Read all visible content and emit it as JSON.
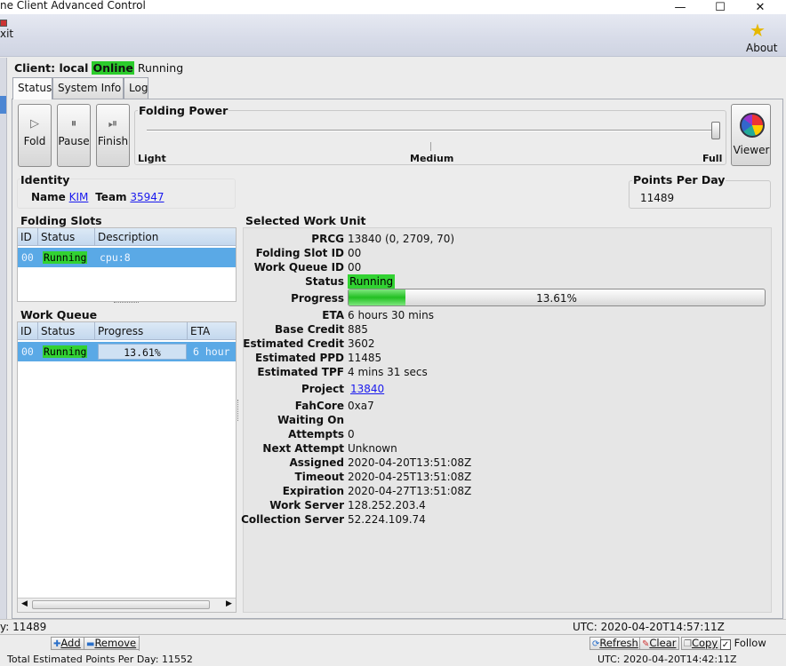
{
  "window": {
    "title": "ne Client Advanced Control",
    "minimize_glyph": "—",
    "maximize_glyph": "☐",
    "close_glyph": "✕"
  },
  "menu": {
    "exit_label": "xit",
    "about_label": "About",
    "about_icon": "star-icon"
  },
  "client": {
    "label": "Client: local",
    "online": "Online",
    "state": "Running"
  },
  "tabs": [
    "Status",
    "System Info",
    "Log"
  ],
  "controls": {
    "fold": "Fold",
    "pause": "Pause",
    "finish": "Finish",
    "viewer": "Viewer",
    "fold_glyph": "▷",
    "pause_glyph": "⏸",
    "finish_glyph": "⏯"
  },
  "folding_power": {
    "title": "Folding Power",
    "light": "Light",
    "medium": "Medium",
    "full": "Full",
    "level": 1.0
  },
  "identity": {
    "title": "Identity",
    "name_label": "Name",
    "name_value": "KIM",
    "team_label": "Team",
    "team_value": "35947"
  },
  "points_per_day": {
    "title": "Points Per Day",
    "value": "11489"
  },
  "folding_slots": {
    "title": "Folding Slots",
    "columns": [
      "ID",
      "Status",
      "Description"
    ],
    "rows": [
      {
        "id": "00",
        "status": "Running",
        "description": "cpu:8"
      }
    ]
  },
  "work_queue": {
    "title": "Work Queue",
    "columns": [
      "ID",
      "Status",
      "Progress",
      "ETA"
    ],
    "rows": [
      {
        "id": "00",
        "status": "Running",
        "progress": "13.61%",
        "eta": "6 hour"
      }
    ]
  },
  "work_unit": {
    "title": "Selected Work Unit",
    "prcg_label": "PRCG",
    "prcg": "13840 (0, 2709, 70)",
    "slot_label": "Folding Slot ID",
    "slot": "00",
    "queue_label": "Work Queue ID",
    "queue": "00",
    "status_label": "Status",
    "status": "Running",
    "progress_label": "Progress",
    "progress": "13.61%",
    "progress_fraction": 0.1361,
    "eta_label": "ETA",
    "eta": "6 hours 30 mins",
    "base_credit_label": "Base Credit",
    "base_credit": "885",
    "est_credit_label": "Estimated Credit",
    "est_credit": "3602",
    "est_ppd_label": "Estimated PPD",
    "est_ppd": "11485",
    "est_tpf_label": "Estimated TPF",
    "est_tpf": "4 mins 31 secs",
    "project_label": "Project",
    "project": "13840",
    "fahcore_label": "FahCore",
    "fahcore": "0xa7",
    "waiting_label": "Waiting On",
    "waiting": "",
    "attempts_label": "Attempts",
    "attempts": "0",
    "next_attempt_label": "Next Attempt",
    "next_attempt": "Unknown",
    "assigned_label": "Assigned",
    "assigned": "2020-04-20T13:51:08Z",
    "timeout_label": "Timeout",
    "timeout": "2020-04-25T13:51:08Z",
    "expiration_label": "Expiration",
    "expiration": "2020-04-27T13:51:08Z",
    "work_server_label": "Work Server",
    "work_server": "128.252.203.4",
    "collection_server_label": "Collection Server",
    "collection_server": "52.224.109.74"
  },
  "status_bar": {
    "left": "y: 11489",
    "utc": "UTC: 2020-04-20T14:57:11Z"
  },
  "bottom_bar": {
    "add": "Add",
    "remove": "Remove",
    "refresh": "Refresh",
    "clear": "Clear",
    "copy": "Copy",
    "follow": "Follow",
    "follow_checked": true,
    "total": "Total Estimated Points Per Day: 11552",
    "utc": "UTC: 2020-04-20T14:42:11Z"
  },
  "colors": {
    "online": "#2ccc2c",
    "running": "#32d232",
    "selection": "#5aa9e6",
    "link": "#1a1aee"
  }
}
